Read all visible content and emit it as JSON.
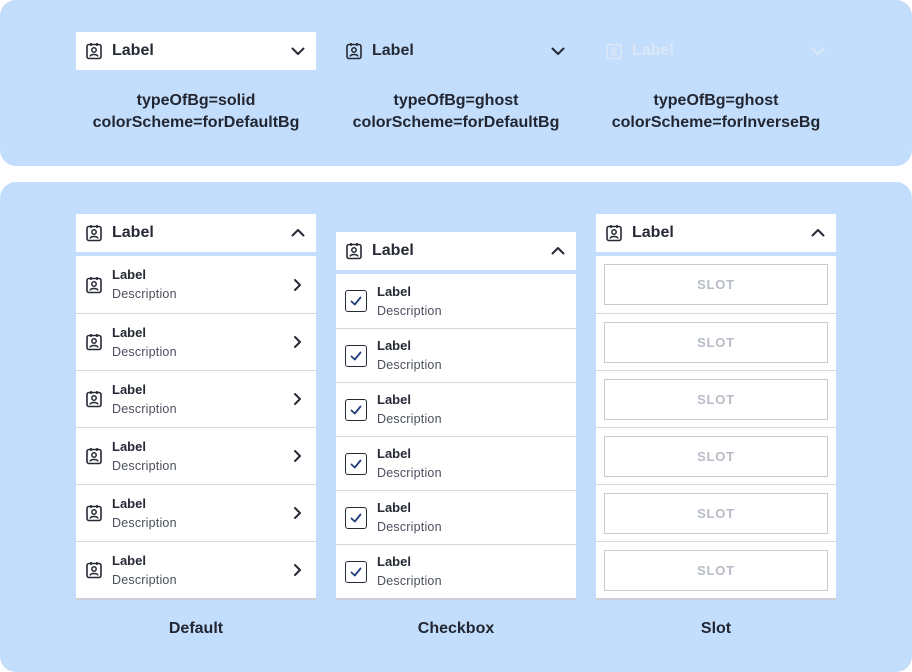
{
  "colors": {
    "panel_bg": "#c2defc",
    "surface": "#ffffff",
    "text": "#262a35",
    "inverse_text": "#dbe7f6",
    "divider": "#d3d7de",
    "slot_text": "#b7bcc6"
  },
  "icons": {
    "item": "badge-icon",
    "expand": "chevron-down-icon",
    "collapse": "chevron-up-icon",
    "navigate": "chevron-right-icon",
    "checked": "checkbox-checked-icon"
  },
  "top_variants": [
    {
      "label": "Label",
      "caption_line1": "typeOfBg=solid",
      "caption_line2": "colorScheme=forDefaultBg"
    },
    {
      "label": "Label",
      "caption_line1": "typeOfBg=ghost",
      "caption_line2": "colorScheme=forDefaultBg"
    },
    {
      "label": "Label",
      "caption_line1": "typeOfBg=ghost",
      "caption_line2": "colorScheme=forInverseBg"
    }
  ],
  "lists": {
    "default": {
      "header_label": "Label",
      "footer_label": "Default",
      "items": [
        {
          "label": "Label",
          "description": "Description"
        },
        {
          "label": "Label",
          "description": "Description"
        },
        {
          "label": "Label",
          "description": "Description"
        },
        {
          "label": "Label",
          "description": "Description"
        },
        {
          "label": "Label",
          "description": "Description"
        },
        {
          "label": "Label",
          "description": "Description"
        }
      ]
    },
    "checkbox": {
      "header_label": "Label",
      "footer_label": "Checkbox",
      "items": [
        {
          "label": "Label",
          "description": "Description",
          "checked": true
        },
        {
          "label": "Label",
          "description": "Description",
          "checked": true
        },
        {
          "label": "Label",
          "description": "Description",
          "checked": true
        },
        {
          "label": "Label",
          "description": "Description",
          "checked": true
        },
        {
          "label": "Label",
          "description": "Description",
          "checked": true
        },
        {
          "label": "Label",
          "description": "Description",
          "checked": true
        }
      ]
    },
    "slot": {
      "header_label": "Label",
      "footer_label": "Slot",
      "items": [
        {
          "slot_text": "SLOT"
        },
        {
          "slot_text": "SLOT"
        },
        {
          "slot_text": "SLOT"
        },
        {
          "slot_text": "SLOT"
        },
        {
          "slot_text": "SLOT"
        },
        {
          "slot_text": "SLOT"
        }
      ]
    }
  }
}
